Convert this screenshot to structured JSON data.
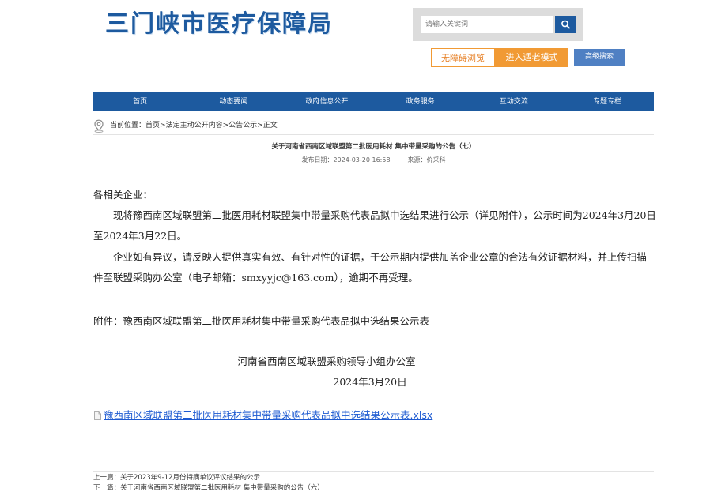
{
  "header": {
    "site_title": "三门峡市医疗保障局",
    "search_placeholder": "请输入关键词",
    "accessibility_label": "无障碍浏览",
    "elder_mode_label": "进入适老模式",
    "advanced_search_label": "高级搜索"
  },
  "nav": {
    "items": [
      "首页",
      "动态要闻",
      "政府信息公开",
      "政务服务",
      "互动交流",
      "专题专栏"
    ]
  },
  "breadcrumb": {
    "prefix": "当前位置：",
    "home": "首页",
    "sep1": ">",
    "section": "法定主动公开内容",
    "sep2": ">",
    "category": "公告公示",
    "sep3": ">",
    "current": "正文"
  },
  "article": {
    "title": "关于河南省西南区域联盟第二批医用耗材 集中带量采购的公告（七）",
    "publish_label": "发布日期：",
    "publish_date": "2024-03-20 16:58",
    "source_label": "来源：",
    "source": "价采科",
    "salutation": "各相关企业：",
    "paragraph1": "现将豫西南区域联盟第二批医用耗材联盟集中带量采购代表品拟中选结果进行公示（详见附件），公示时间为2024年3月20日至2024年3月22日。",
    "paragraph2": "企业如有异议，请反映人提供真实有效、有针对性的证据，于公示期内提供加盖企业公章的合法有效证据材料，并上传扫描件至联盟采购办公室（电子邮箱：smxyyjc@163.com），逾期不再受理。",
    "attachment_note": "附件：豫西南区域联盟第二批医用耗材集中带量采购代表品拟中选结果公示表",
    "signature_office": "河南省西南区域联盟采购领导小组办公室",
    "signature_date": "2024年3月20日",
    "attachment_link": "豫西南区域联盟第二批医用耗材集中带量采购代表品拟中选结果公示表.xlsx"
  },
  "pager": {
    "prev_label": "上一篇：",
    "prev_title": "关于2023年9-12月份特病单议评议结果的公示",
    "next_label": "下一篇：",
    "next_title": "关于河南省西南区域联盟第二批医用耗材 集中带量采购的公告（六）"
  },
  "colors": {
    "brand_blue": "#1d5a9f",
    "accent_orange": "#f19a34",
    "link_blue": "#1d5ad1"
  }
}
